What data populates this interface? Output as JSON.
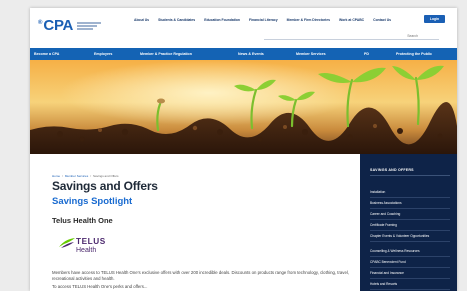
{
  "header": {
    "logo_text": "CPA",
    "logo_mark": "®",
    "top_links": [
      "About Us",
      "Students & Candidates",
      "Education Foundation",
      "Financial Literacy",
      "Member & Firm Directories",
      "Work at CPABC",
      "Contact Us"
    ],
    "login_label": "Login",
    "search_placeholder": "Search"
  },
  "mainnav": {
    "items": [
      "Become a CPA",
      "Employers",
      "Member & Practice Regulation",
      "News & Events",
      "Member Services",
      "PD",
      "Protecting the Public"
    ]
  },
  "breadcrumb": {
    "items": [
      "Home",
      "Member Services",
      "Savings and Offers"
    ],
    "separator": "/"
  },
  "main": {
    "title": "Savings and Offers",
    "subtitle": "Savings Spotlight",
    "section_title": "Telus Health One",
    "partner_logo_word": "TELUS",
    "partner_logo_sub": "Health",
    "description": "Members have access to TELUS Health One's exclusive offers with over 200 incredible deals. Discounts on products range from technology, clothing, travel, recreational activities and health.",
    "description_cont": "To access TELUS Health One's perks and offers..."
  },
  "sidebar": {
    "heading": "SAVINGS AND OFFERS",
    "items": [
      "Installation",
      "Business Associations",
      "Career and Coaching",
      "Certificate Framing",
      "Chapter Events & Volunteer Opportunities",
      "Counselling & Wellness Resources",
      "CPABC Benevolent Fund",
      "Financial and Insurance",
      "Hotels and Resorts",
      "Publications"
    ]
  },
  "colors": {
    "brand_blue": "#1463b4",
    "sidebar_navy": "#0e2348",
    "title_dark": "#1f2a38",
    "subtitle_blue": "#1a6bd0",
    "telus_purple": "#4b286d",
    "telus_green": "#66cc00"
  },
  "icons": {
    "search": "search-icon",
    "telus_logo": "telus-leaf-icon"
  }
}
